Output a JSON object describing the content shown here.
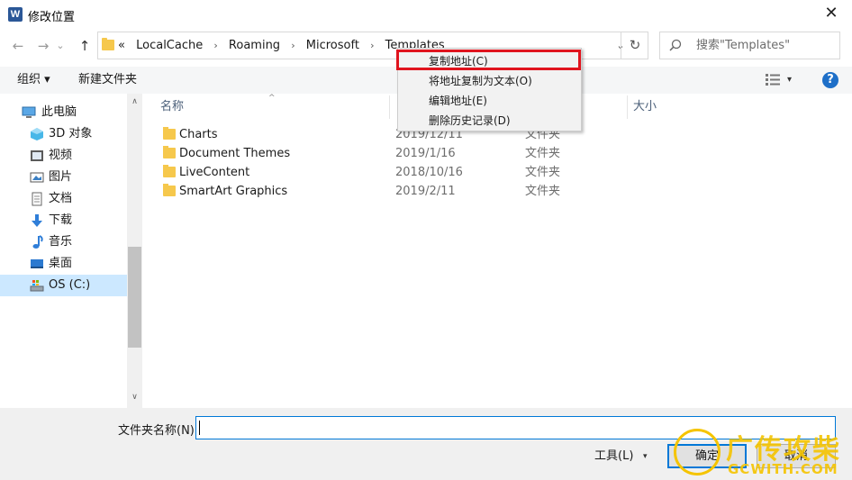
{
  "window": {
    "title": "修改位置",
    "app_icon_letter": "W",
    "close_glyph": "✕"
  },
  "nav": {
    "back_glyph": "←",
    "forward_glyph": "→",
    "dropdown_glyph": "⌄",
    "up_glyph": "↑"
  },
  "address": {
    "overflow": "«",
    "crumbs": [
      "LocalCache",
      "Roaming",
      "Microsoft",
      "Templates"
    ],
    "separator": "›",
    "dropdown_glyph": "⌄",
    "refresh_glyph": "↻"
  },
  "search": {
    "placeholder": "搜索\"Templates\""
  },
  "toolbar": {
    "organize_label": "组织 ▾",
    "new_folder_label": "新建文件夹",
    "view_dropdown": "▾",
    "help_glyph": "?"
  },
  "sidebar": {
    "items": [
      {
        "label": "此电脑",
        "icon": "computer-icon"
      },
      {
        "label": "3D 对象",
        "icon": "cube-icon"
      },
      {
        "label": "视频",
        "icon": "video-icon"
      },
      {
        "label": "图片",
        "icon": "picture-icon"
      },
      {
        "label": "文档",
        "icon": "document-icon"
      },
      {
        "label": "下载",
        "icon": "download-icon"
      },
      {
        "label": "音乐",
        "icon": "music-icon"
      },
      {
        "label": "桌面",
        "icon": "desktop-icon"
      },
      {
        "label": "OS (C:)",
        "icon": "drive-icon",
        "selected": true
      }
    ],
    "scroll_up": "∧",
    "scroll_down": "∨"
  },
  "filelist": {
    "columns": {
      "name": "名称",
      "size": "大小"
    },
    "sort_glyph": "^",
    "rows": [
      {
        "name": "Charts",
        "date": "2019/12/11",
        "type": "文件夹"
      },
      {
        "name": "Document Themes",
        "date": "2019/1/16",
        "type": "文件夹"
      },
      {
        "name": "LiveContent",
        "date": "2018/10/16",
        "type": "文件夹"
      },
      {
        "name": "SmartArt Graphics",
        "date": "2019/2/11",
        "type": "文件夹"
      }
    ]
  },
  "context_menu": {
    "items": [
      "复制地址(C)",
      "将地址复制为文本(O)",
      "编辑地址(E)",
      "删除历史记录(D)"
    ],
    "highlight_color": "#e0141e"
  },
  "bottom": {
    "folder_name_label": "文件夹名称(N):",
    "folder_name_value": "",
    "tools_label": "工具(L)",
    "tools_dropdown": "▾",
    "ok_label": "确定",
    "cancel_label": "取消"
  },
  "watermark": {
    "title": "广传攻柴",
    "subtitle": "GCWITH.COM",
    "color": "#f5c400"
  },
  "colors": {
    "accent": "#0078d7",
    "selection": "#cce8ff",
    "folder": "#f6c84c"
  }
}
